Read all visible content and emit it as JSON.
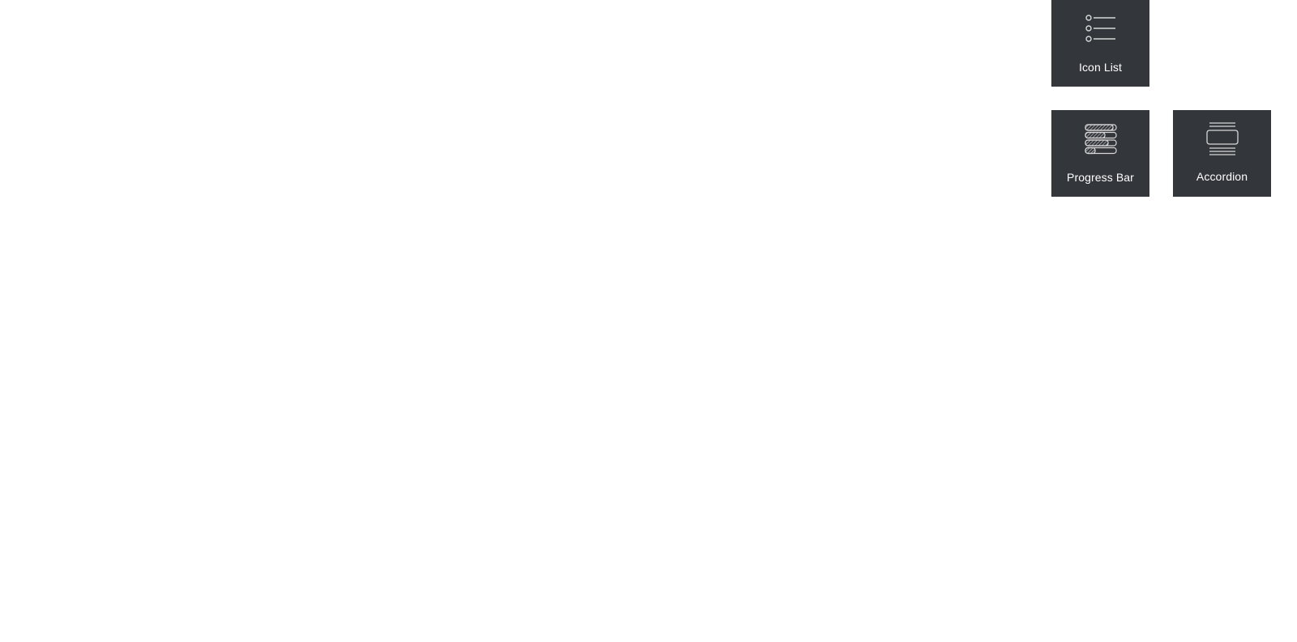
{
  "widgets": [
    {
      "id": "icon-list",
      "label": "Icon List",
      "icon": "icon-list-icon"
    },
    {
      "id": "progress-bar",
      "label": "Progress Bar",
      "icon": "progress-bar-icon"
    },
    {
      "id": "accordion",
      "label": "Accordion",
      "icon": "accordion-icon"
    }
  ],
  "colors": {
    "background": "#ffffff",
    "tile": "#33363b",
    "tile_text": "#ffffff",
    "icon_stroke": "#d8d8d8"
  }
}
